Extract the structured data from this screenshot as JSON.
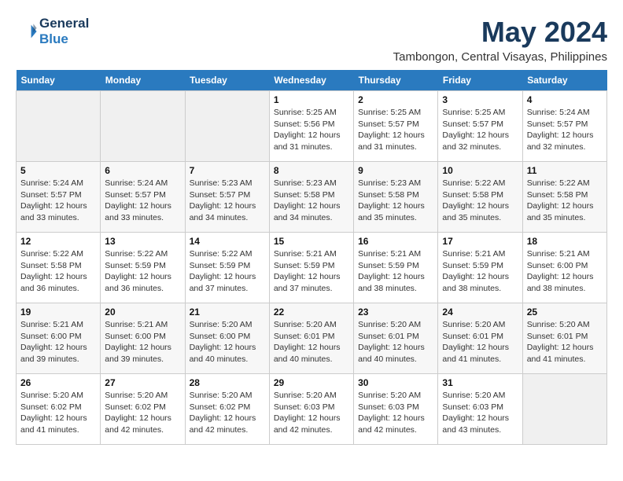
{
  "header": {
    "logo_line1": "General",
    "logo_line2": "Blue",
    "month": "May 2024",
    "location": "Tambongon, Central Visayas, Philippines"
  },
  "weekdays": [
    "Sunday",
    "Monday",
    "Tuesday",
    "Wednesday",
    "Thursday",
    "Friday",
    "Saturday"
  ],
  "weeks": [
    [
      {
        "day": "",
        "info": ""
      },
      {
        "day": "",
        "info": ""
      },
      {
        "day": "",
        "info": ""
      },
      {
        "day": "1",
        "info": "Sunrise: 5:25 AM\nSunset: 5:56 PM\nDaylight: 12 hours\nand 31 minutes."
      },
      {
        "day": "2",
        "info": "Sunrise: 5:25 AM\nSunset: 5:57 PM\nDaylight: 12 hours\nand 31 minutes."
      },
      {
        "day": "3",
        "info": "Sunrise: 5:25 AM\nSunset: 5:57 PM\nDaylight: 12 hours\nand 32 minutes."
      },
      {
        "day": "4",
        "info": "Sunrise: 5:24 AM\nSunset: 5:57 PM\nDaylight: 12 hours\nand 32 minutes."
      }
    ],
    [
      {
        "day": "5",
        "info": "Sunrise: 5:24 AM\nSunset: 5:57 PM\nDaylight: 12 hours\nand 33 minutes."
      },
      {
        "day": "6",
        "info": "Sunrise: 5:24 AM\nSunset: 5:57 PM\nDaylight: 12 hours\nand 33 minutes."
      },
      {
        "day": "7",
        "info": "Sunrise: 5:23 AM\nSunset: 5:57 PM\nDaylight: 12 hours\nand 34 minutes."
      },
      {
        "day": "8",
        "info": "Sunrise: 5:23 AM\nSunset: 5:58 PM\nDaylight: 12 hours\nand 34 minutes."
      },
      {
        "day": "9",
        "info": "Sunrise: 5:23 AM\nSunset: 5:58 PM\nDaylight: 12 hours\nand 35 minutes."
      },
      {
        "day": "10",
        "info": "Sunrise: 5:22 AM\nSunset: 5:58 PM\nDaylight: 12 hours\nand 35 minutes."
      },
      {
        "day": "11",
        "info": "Sunrise: 5:22 AM\nSunset: 5:58 PM\nDaylight: 12 hours\nand 35 minutes."
      }
    ],
    [
      {
        "day": "12",
        "info": "Sunrise: 5:22 AM\nSunset: 5:58 PM\nDaylight: 12 hours\nand 36 minutes."
      },
      {
        "day": "13",
        "info": "Sunrise: 5:22 AM\nSunset: 5:59 PM\nDaylight: 12 hours\nand 36 minutes."
      },
      {
        "day": "14",
        "info": "Sunrise: 5:22 AM\nSunset: 5:59 PM\nDaylight: 12 hours\nand 37 minutes."
      },
      {
        "day": "15",
        "info": "Sunrise: 5:21 AM\nSunset: 5:59 PM\nDaylight: 12 hours\nand 37 minutes."
      },
      {
        "day": "16",
        "info": "Sunrise: 5:21 AM\nSunset: 5:59 PM\nDaylight: 12 hours\nand 38 minutes."
      },
      {
        "day": "17",
        "info": "Sunrise: 5:21 AM\nSunset: 5:59 PM\nDaylight: 12 hours\nand 38 minutes."
      },
      {
        "day": "18",
        "info": "Sunrise: 5:21 AM\nSunset: 6:00 PM\nDaylight: 12 hours\nand 38 minutes."
      }
    ],
    [
      {
        "day": "19",
        "info": "Sunrise: 5:21 AM\nSunset: 6:00 PM\nDaylight: 12 hours\nand 39 minutes."
      },
      {
        "day": "20",
        "info": "Sunrise: 5:21 AM\nSunset: 6:00 PM\nDaylight: 12 hours\nand 39 minutes."
      },
      {
        "day": "21",
        "info": "Sunrise: 5:20 AM\nSunset: 6:00 PM\nDaylight: 12 hours\nand 40 minutes."
      },
      {
        "day": "22",
        "info": "Sunrise: 5:20 AM\nSunset: 6:01 PM\nDaylight: 12 hours\nand 40 minutes."
      },
      {
        "day": "23",
        "info": "Sunrise: 5:20 AM\nSunset: 6:01 PM\nDaylight: 12 hours\nand 40 minutes."
      },
      {
        "day": "24",
        "info": "Sunrise: 5:20 AM\nSunset: 6:01 PM\nDaylight: 12 hours\nand 41 minutes."
      },
      {
        "day": "25",
        "info": "Sunrise: 5:20 AM\nSunset: 6:01 PM\nDaylight: 12 hours\nand 41 minutes."
      }
    ],
    [
      {
        "day": "26",
        "info": "Sunrise: 5:20 AM\nSunset: 6:02 PM\nDaylight: 12 hours\nand 41 minutes."
      },
      {
        "day": "27",
        "info": "Sunrise: 5:20 AM\nSunset: 6:02 PM\nDaylight: 12 hours\nand 42 minutes."
      },
      {
        "day": "28",
        "info": "Sunrise: 5:20 AM\nSunset: 6:02 PM\nDaylight: 12 hours\nand 42 minutes."
      },
      {
        "day": "29",
        "info": "Sunrise: 5:20 AM\nSunset: 6:03 PM\nDaylight: 12 hours\nand 42 minutes."
      },
      {
        "day": "30",
        "info": "Sunrise: 5:20 AM\nSunset: 6:03 PM\nDaylight: 12 hours\nand 42 minutes."
      },
      {
        "day": "31",
        "info": "Sunrise: 5:20 AM\nSunset: 6:03 PM\nDaylight: 12 hours\nand 43 minutes."
      },
      {
        "day": "",
        "info": ""
      }
    ]
  ]
}
